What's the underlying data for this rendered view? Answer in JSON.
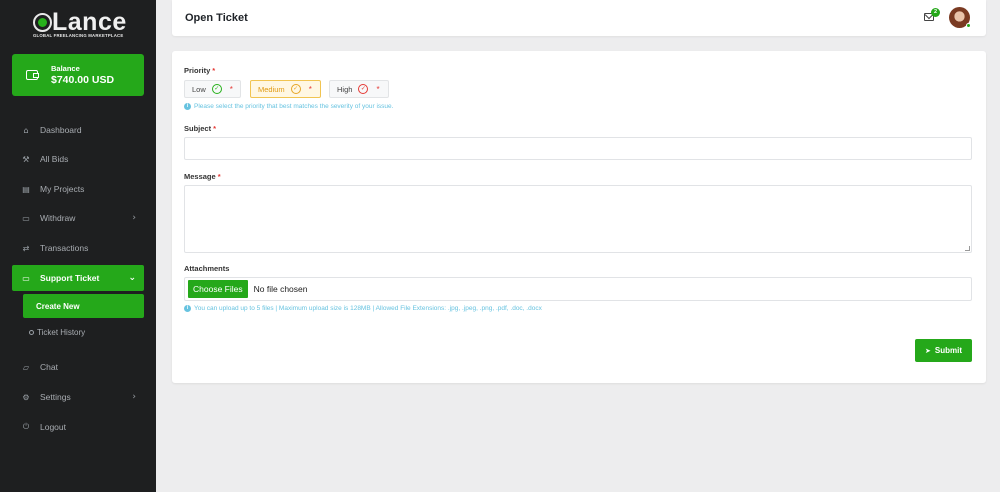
{
  "brand": {
    "name": "Lance",
    "tagline": "GLOBAL FREELANCING MARKETPLACE",
    "accent": "#25a81a"
  },
  "balance": {
    "label": "Balance",
    "amount": "$740.00 USD"
  },
  "sidebar": {
    "items": [
      {
        "label": "Dashboard",
        "icon": "home-icon"
      },
      {
        "label": "All Bids",
        "icon": "gavel-icon"
      },
      {
        "label": "My Projects",
        "icon": "briefcase-icon"
      },
      {
        "label": "Withdraw",
        "icon": "wallet-icon"
      },
      {
        "label": "Transactions",
        "icon": "transfer-icon"
      },
      {
        "label": "Support Ticket",
        "icon": "ticket-icon"
      },
      {
        "label": "Chat",
        "icon": "chat-icon"
      },
      {
        "label": "Settings",
        "icon": "gear-icon"
      },
      {
        "label": "Logout",
        "icon": "power-icon"
      }
    ],
    "support_sub": [
      {
        "label": "Create New"
      },
      {
        "label": "Ticket History"
      }
    ]
  },
  "header": {
    "title": "Open Ticket",
    "notifications_count": "2"
  },
  "form": {
    "priority_label": "Priority",
    "priority_options": [
      "Low",
      "Medium",
      "High"
    ],
    "selected_priority": "Medium",
    "priority_hint": "Please select the priority that best matches the severity of your issue.",
    "subject_label": "Subject",
    "subject_value": "",
    "message_label": "Message",
    "message_value": "",
    "attachments_label": "Attachments",
    "choose_files": "Choose Files",
    "file_status": "No file chosen",
    "upload_hint": "You can upload up to 5 files | Maximum upload size is 128MB | Allowed File Extensions: .jpg, .jpeg, .png, .pdf, .doc, .docx",
    "submit_label": "Submit",
    "required_mark": "*"
  }
}
